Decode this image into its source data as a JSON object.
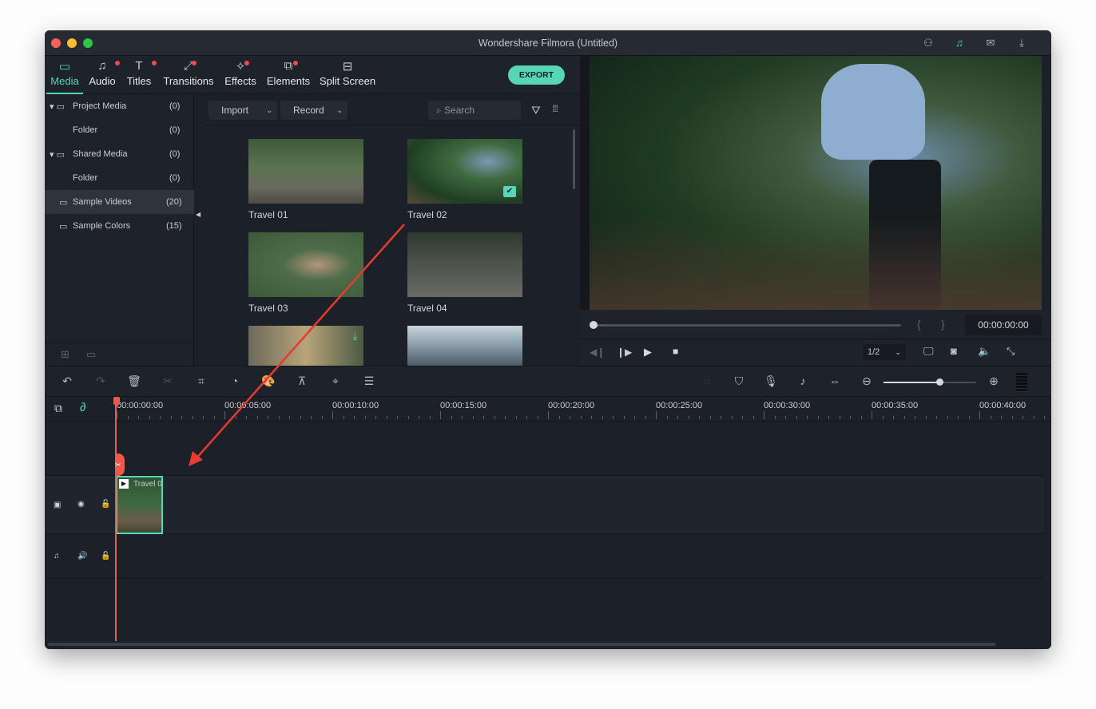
{
  "window": {
    "title": "Wondershare Filmora (Untitled)"
  },
  "titlebar_icons": [
    "user-icon",
    "headset-icon",
    "mail-icon",
    "download-icon"
  ],
  "tabs": [
    {
      "label": "Media",
      "icon": "folder-icon",
      "active": true,
      "dot": false
    },
    {
      "label": "Audio",
      "icon": "music-icon",
      "dot": true
    },
    {
      "label": "Titles",
      "icon": "text-icon",
      "dot": true
    },
    {
      "label": "Transitions",
      "icon": "transition-icon",
      "dot": true
    },
    {
      "label": "Effects",
      "icon": "effects-icon",
      "dot": true
    },
    {
      "label": "Elements",
      "icon": "elements-icon",
      "dot": true
    },
    {
      "label": "Split Screen",
      "icon": "split-screen-icon",
      "dot": false
    }
  ],
  "export_label": "EXPORT",
  "sidebar": {
    "items": [
      {
        "label": "Project Media",
        "count": "(0)"
      },
      {
        "label": "Folder",
        "count": "(0)"
      },
      {
        "label": "Shared Media",
        "count": "(0)"
      },
      {
        "label": "Folder",
        "count": "(0)"
      },
      {
        "label": "Sample Videos",
        "count": "(20)"
      },
      {
        "label": "Sample Colors",
        "count": "(15)"
      }
    ]
  },
  "media": {
    "import_label": "Import",
    "record_label": "Record",
    "search_placeholder": "Search",
    "items": [
      {
        "label": "Travel 01"
      },
      {
        "label": "Travel 02",
        "checked": true
      },
      {
        "label": "Travel 03"
      },
      {
        "label": "Travel 04"
      }
    ]
  },
  "preview": {
    "timecode": "00:00:00:00",
    "quality": "1/2",
    "progress": 0
  },
  "timeline": {
    "ruler": [
      "00:00:00:00",
      "00:00:05:00",
      "00:00:10:00",
      "00:00:15:00",
      "00:00:20:00",
      "00:00:25:00",
      "00:00:30:00",
      "00:00:35:00",
      "00:00:40:00"
    ],
    "clip_label": "Travel 0",
    "zoom_level": 0.6
  },
  "colors": {
    "accent": "#57d6b7",
    "playhead": "#f0584a",
    "arrow": "#e83a2e"
  }
}
